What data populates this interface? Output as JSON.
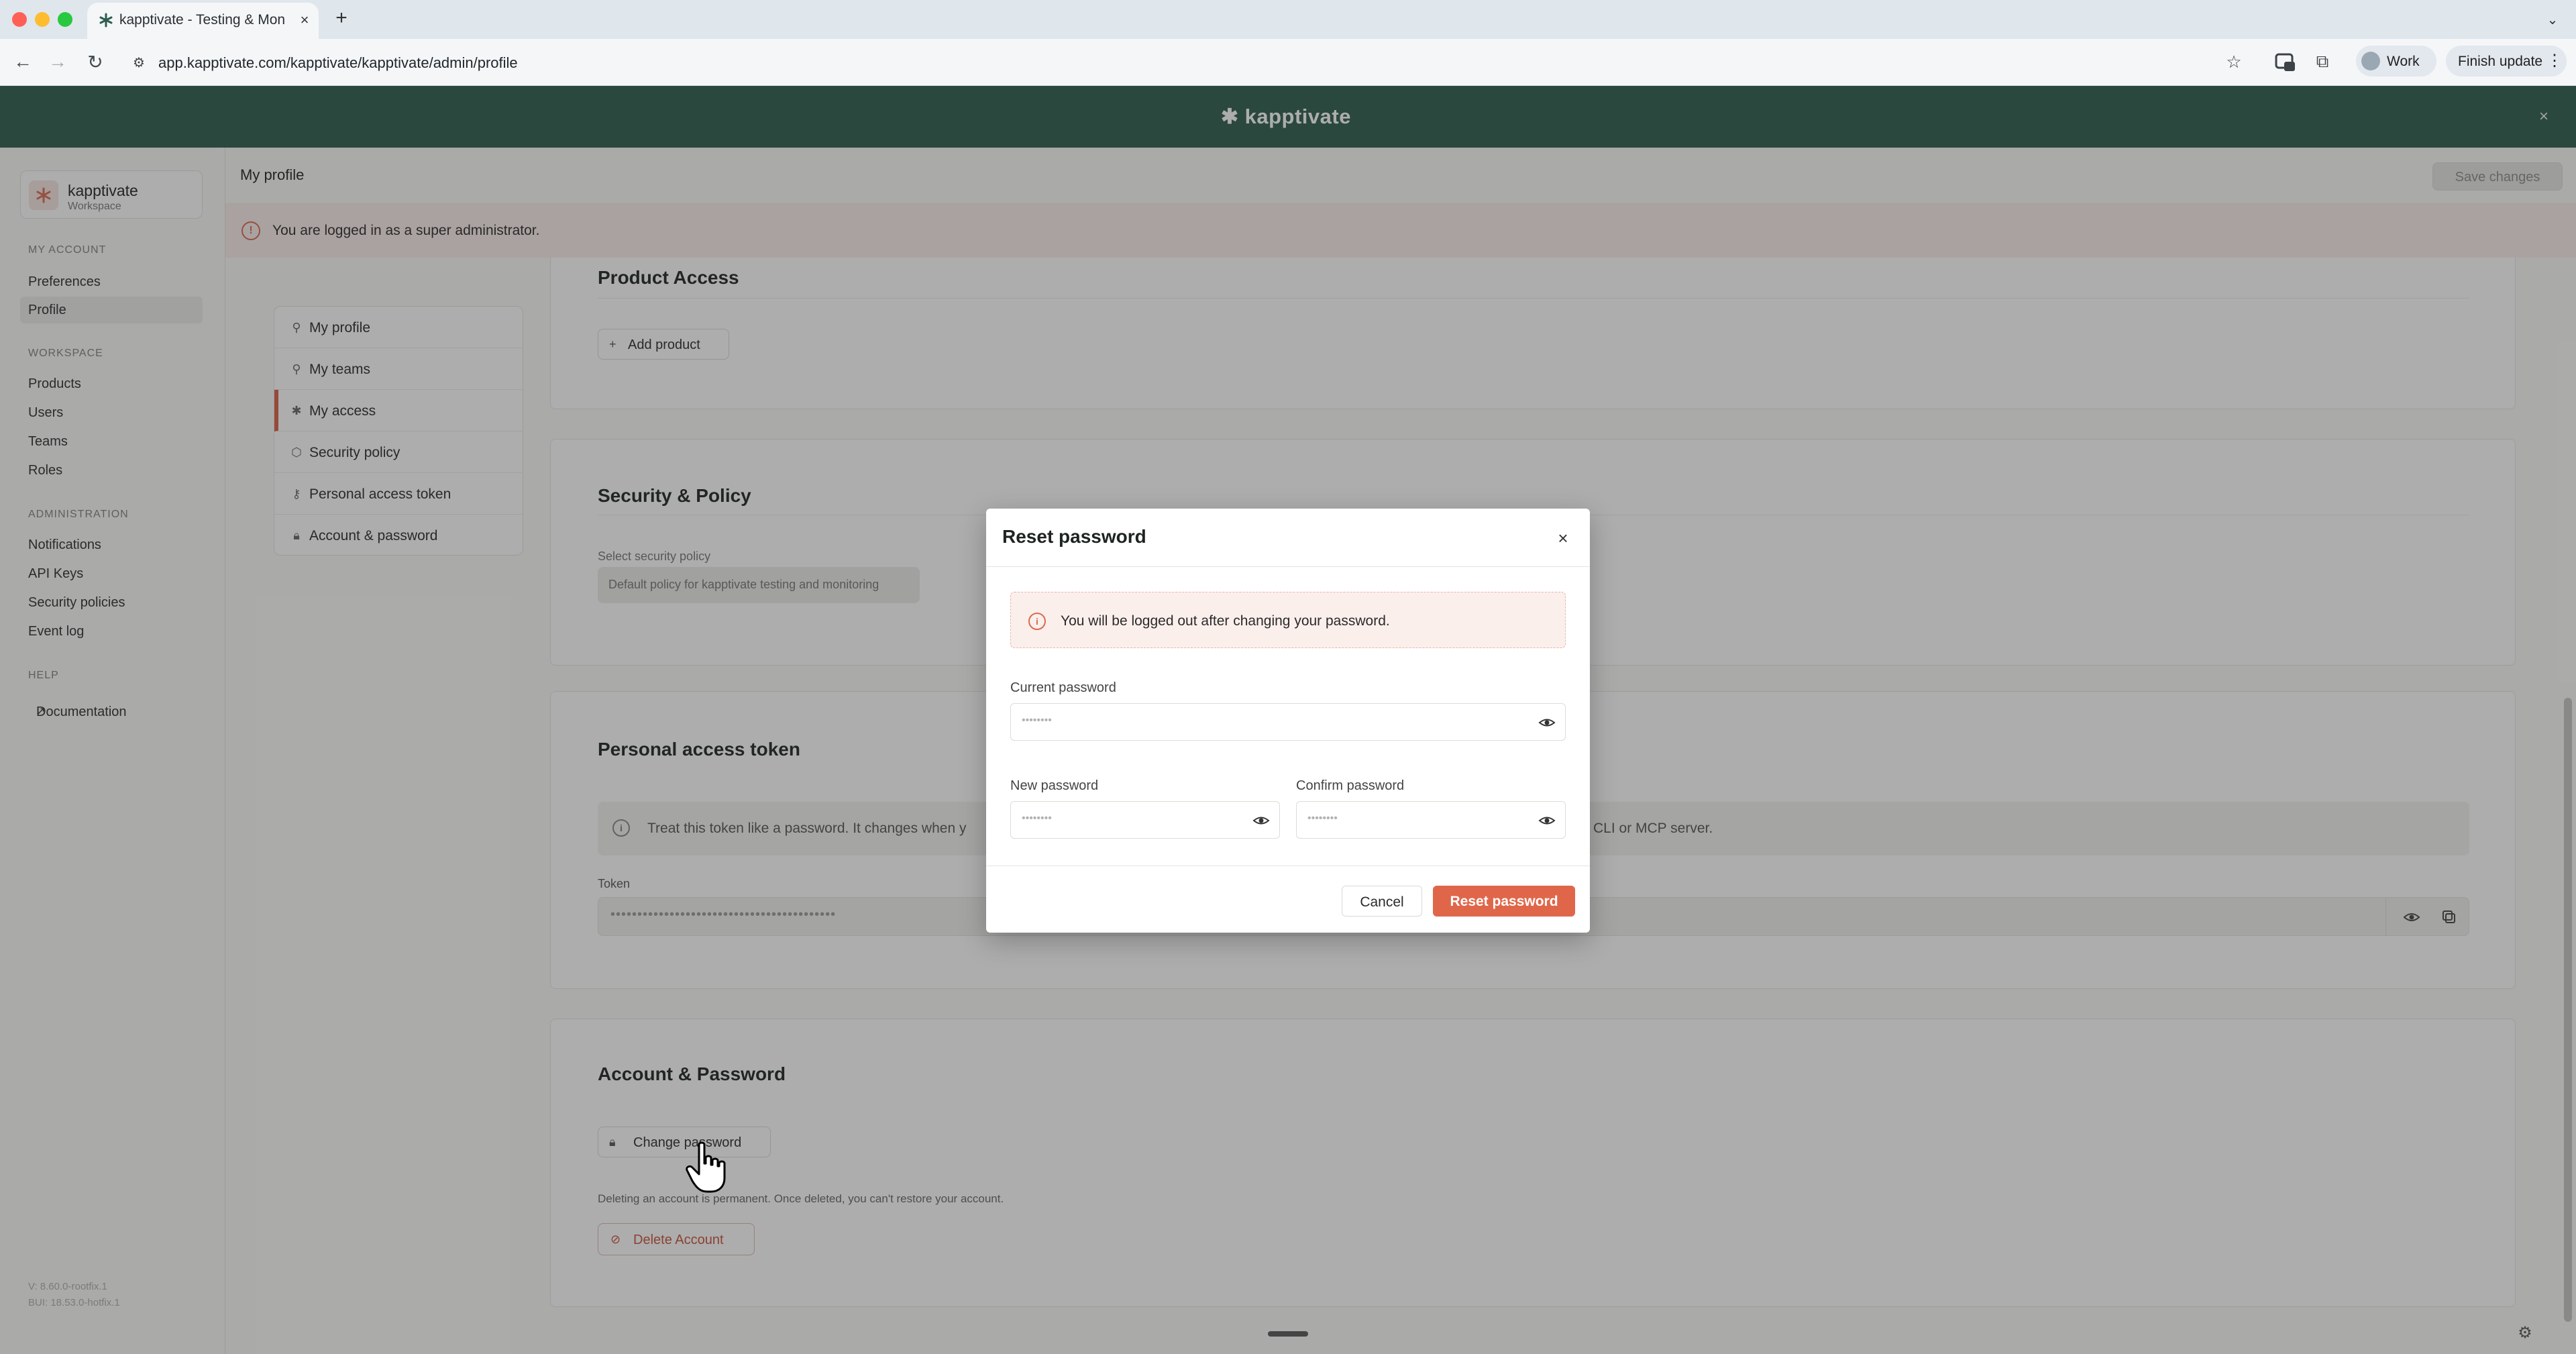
{
  "browser": {
    "tab_title": "kapptivate - Testing & Monitoring",
    "url": "app.kapptivate.com/kapptivate/kapptivate/admin/profile",
    "profile_label": "Work",
    "finish_update_label": "Finish update"
  },
  "header": {
    "brand": "kapptivate"
  },
  "sidebar": {
    "workspace_name": "kapptivate",
    "workspace_sub": "Workspace",
    "sections": {
      "my_account": "MY ACCOUNT",
      "workspace": "WORKSPACE",
      "administration": "ADMINISTRATION",
      "help": "HELP"
    },
    "items": {
      "preferences": "Preferences",
      "profile": "Profile",
      "products": "Products",
      "users": "Users",
      "teams": "Teams",
      "roles": "Roles",
      "notifications": "Notifications",
      "api_keys": "API Keys",
      "security_policies": "Security policies",
      "event_log": "Event log",
      "documentation": "Documentation"
    },
    "version_1": "V: 8.60.0-rootfix.1",
    "version_2": "BUI: 18.53.0-hotfix.1"
  },
  "page": {
    "title": "My profile",
    "save_label": "Save changes",
    "admin_banner": "You are logged in as a super administrator."
  },
  "subnav": {
    "my_profile": "My profile",
    "my_teams": "My teams",
    "my_access": "My access",
    "security_policy": "Security policy",
    "personal_access_token": "Personal access token",
    "account_password": "Account & password"
  },
  "product_access": {
    "title": "Product Access",
    "add_label": "Add product"
  },
  "security_policy": {
    "title": "Security & Policy",
    "select_label": "Select security policy",
    "selected": "Default policy for kapptivate testing and monitoring"
  },
  "token": {
    "title": "Personal access token",
    "note_left": "Treat this token like a password. It changes when y",
    "note_right": "CLI or MCP server.",
    "label": "Token",
    "masked": "••••••••••••••••••••••••••••••••••••••••••"
  },
  "account": {
    "title": "Account & Password",
    "change_label": "Change password",
    "delete_note": "Deleting an account is permanent. Once deleted, you can't restore your account.",
    "delete_label": "Delete Account"
  },
  "modal": {
    "title": "Reset password",
    "warning": "You will be logged out after changing your password.",
    "current_label": "Current password",
    "new_label": "New password",
    "confirm_label": "Confirm password",
    "masked": "••••••••",
    "cancel_label": "Cancel",
    "reset_label": "Reset password"
  },
  "colors": {
    "header": "#2c5d4d",
    "accent": "#e0664a",
    "banner": "#fbeeea"
  }
}
